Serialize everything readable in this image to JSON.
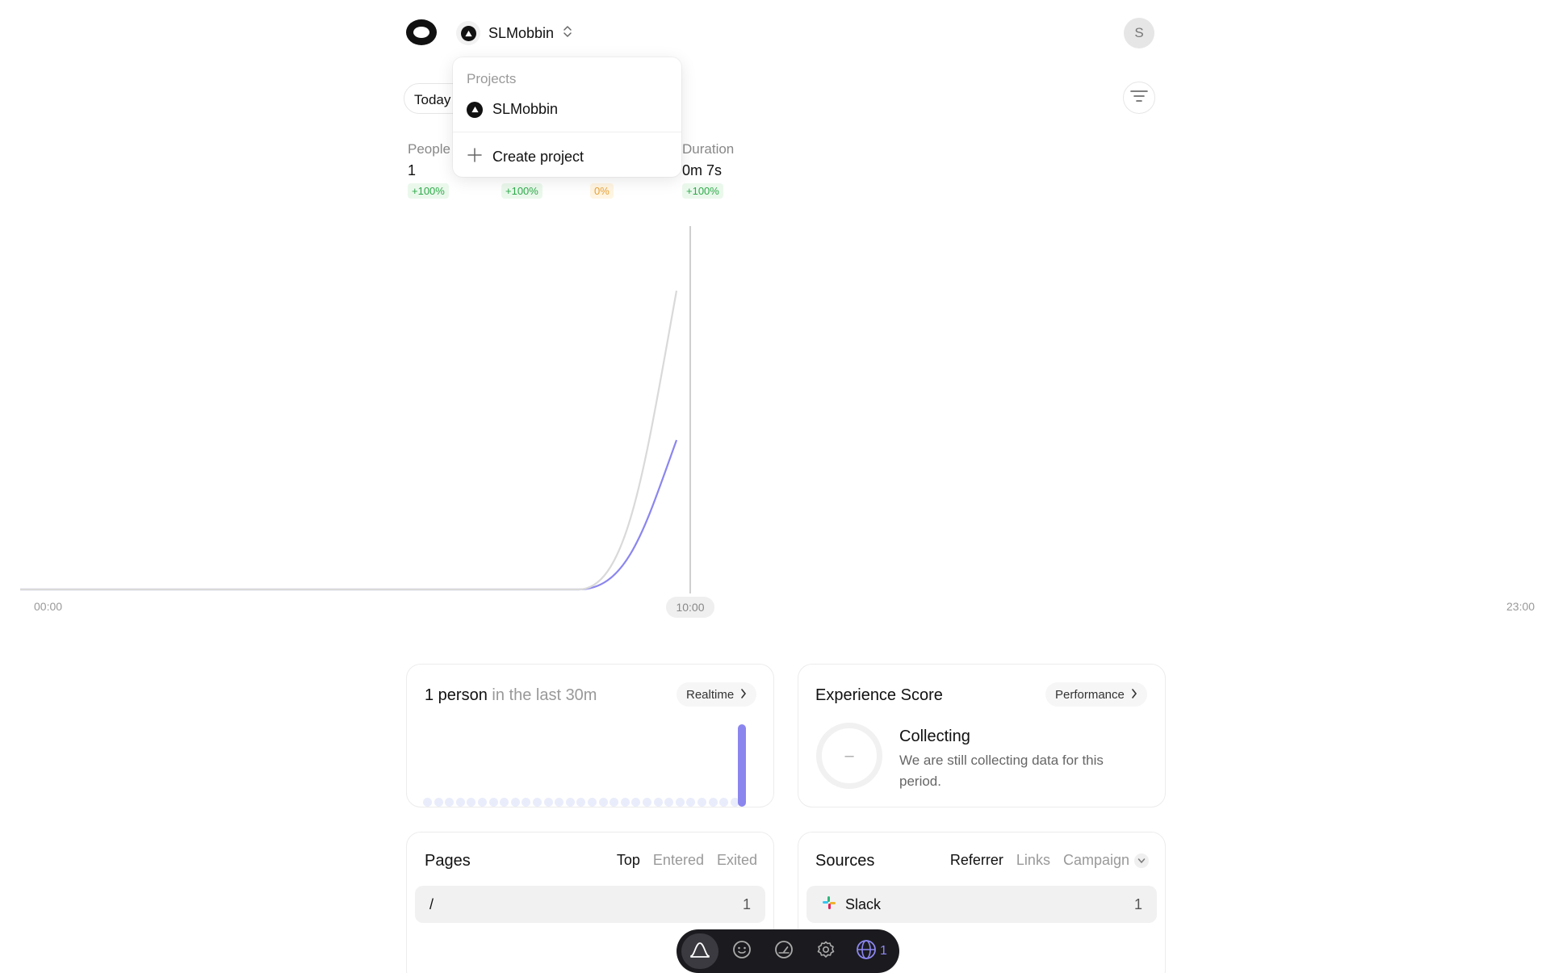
{
  "header": {
    "project_name": "SLMobbin",
    "avatar_initial": "S"
  },
  "toolbar": {
    "date_label": "Today"
  },
  "metrics": [
    {
      "label": "People",
      "value": "1",
      "change": "+100%"
    },
    {
      "label": "",
      "value": "",
      "change": "+100%"
    },
    {
      "label": "",
      "value": "",
      "change": "0%"
    },
    {
      "label": "Duration",
      "value": "0m 7s",
      "change": "+100%"
    }
  ],
  "dropdown": {
    "title": "Projects",
    "items": [
      {
        "label": "SLMobbin"
      }
    ],
    "create_label": "Create project"
  },
  "chart_data": {
    "type": "line",
    "x_ticks": [
      "00:00",
      "10:00",
      "23:00"
    ],
    "current_marker": "10:00",
    "series": [
      {
        "color": "#8b86ee",
        "x": [
          "00:00",
          "09:00",
          "10:00"
        ],
        "values": [
          0,
          0,
          1
        ]
      },
      {
        "color": "#d9d9d9",
        "x": [
          "00:00",
          "09:00",
          "10:00"
        ],
        "values": [
          0,
          0,
          2
        ]
      }
    ],
    "grid": false
  },
  "realtime_card": {
    "count_text": "1 person",
    "suffix_text": " in the last 30m",
    "button_label": "Realtime",
    "bar_count": 30,
    "last_bar_value": 1
  },
  "score_card": {
    "title": "Experience Score",
    "button_label": "Performance",
    "ring_text": "–",
    "status": "Collecting",
    "description": "We are still collecting data for this period."
  },
  "pages_card": {
    "title": "Pages",
    "tabs": [
      "Top",
      "Entered",
      "Exited"
    ],
    "rows": [
      {
        "path": "/",
        "count": "1"
      }
    ]
  },
  "sources_card": {
    "title": "Sources",
    "tabs": [
      "Referrer",
      "Links",
      "Campaign"
    ],
    "rows": [
      {
        "name": "Slack",
        "count": "1"
      }
    ]
  },
  "dock": {
    "globe_count": "1"
  },
  "colors": {
    "accent": "#8b86ee",
    "dark": "#1b1b1f"
  }
}
